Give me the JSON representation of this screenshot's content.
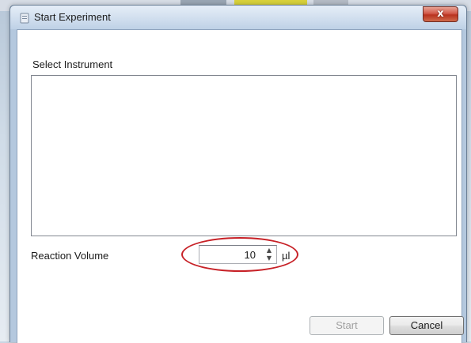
{
  "window": {
    "title": "Start Experiment",
    "close_glyph": "x"
  },
  "instrument": {
    "label": "Select Instrument",
    "items": []
  },
  "reaction_volume": {
    "label": "Reaction Volume",
    "value": "10",
    "unit": "µl",
    "up_glyph": "▲",
    "down_glyph": "▼"
  },
  "buttons": {
    "start": "Start",
    "cancel": "Cancel"
  },
  "colors": {
    "highlight": "#c72127",
    "close_button": "#c7402c"
  },
  "icons": {
    "title": "app-icon",
    "close": "close-icon"
  }
}
